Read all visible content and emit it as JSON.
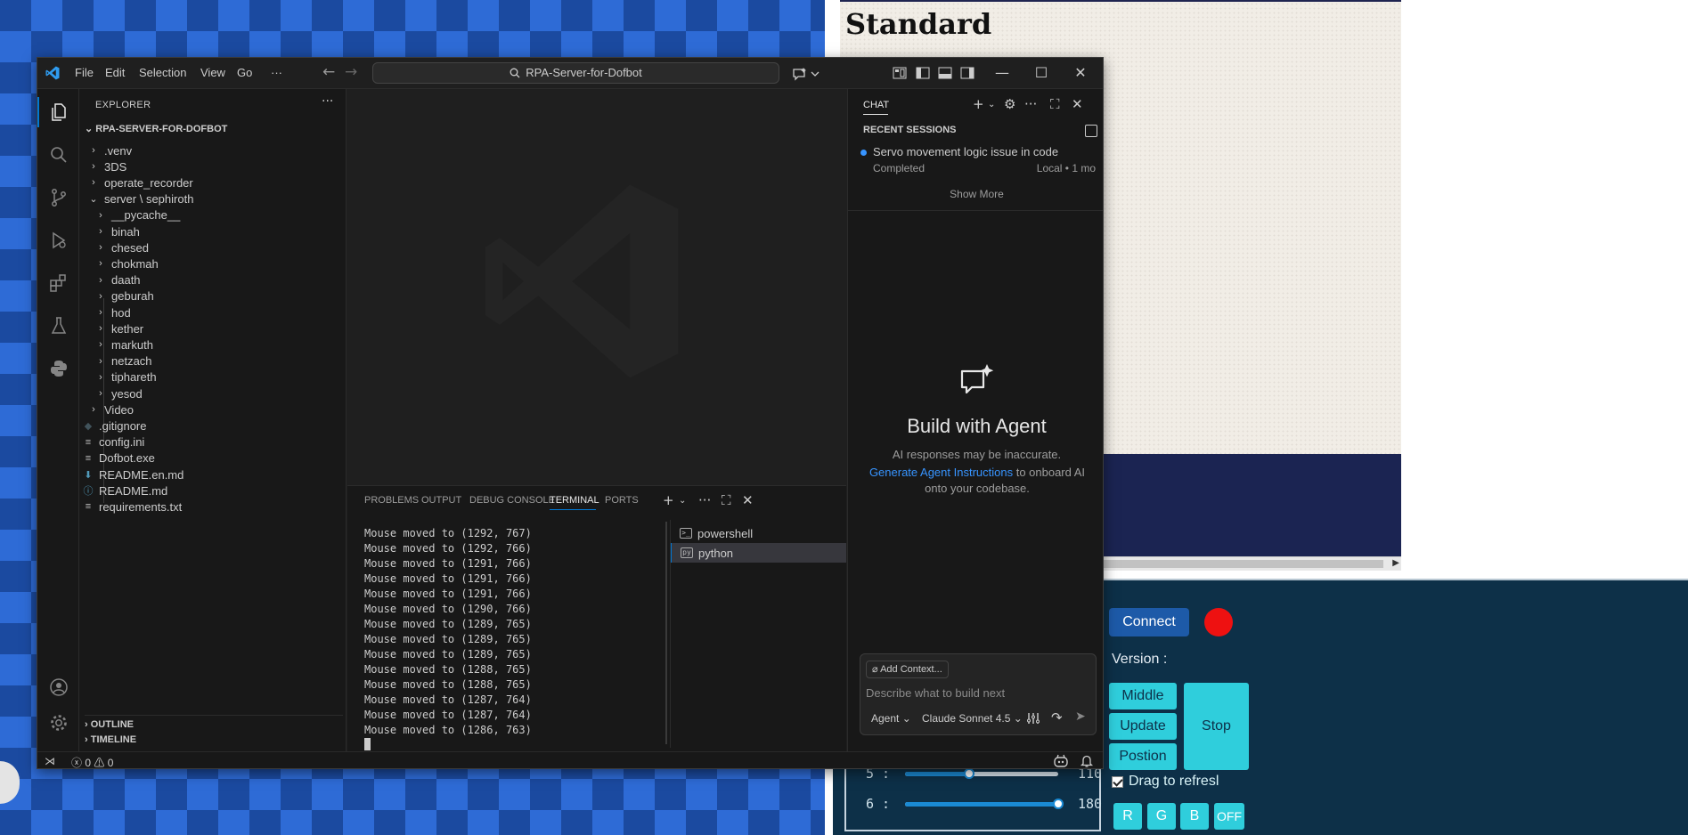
{
  "window": {
    "menus": [
      "File",
      "Edit",
      "Selection",
      "View",
      "Go",
      "···"
    ],
    "search_text": "RPA-Server-for-Dofbot"
  },
  "explorer": {
    "title": "EXPLORER",
    "root": "RPA-SERVER-FOR-DOFBOT",
    "items": [
      {
        "label": ".venv",
        "type": "folder",
        "depth": 0,
        "expanded": false
      },
      {
        "label": "3DS",
        "type": "folder",
        "depth": 0,
        "expanded": false
      },
      {
        "label": "operate_recorder",
        "type": "folder",
        "depth": 0,
        "expanded": false
      },
      {
        "label": "server \\ sephiroth",
        "type": "folder",
        "depth": 0,
        "expanded": true
      },
      {
        "label": "__pycache__",
        "type": "folder",
        "depth": 1,
        "expanded": false
      },
      {
        "label": "binah",
        "type": "folder",
        "depth": 1,
        "expanded": false
      },
      {
        "label": "chesed",
        "type": "folder",
        "depth": 1,
        "expanded": false
      },
      {
        "label": "chokmah",
        "type": "folder",
        "depth": 1,
        "expanded": false
      },
      {
        "label": "daath",
        "type": "folder",
        "depth": 1,
        "expanded": false
      },
      {
        "label": "geburah",
        "type": "folder",
        "depth": 1,
        "expanded": false
      },
      {
        "label": "hod",
        "type": "folder",
        "depth": 1,
        "expanded": false
      },
      {
        "label": "kether",
        "type": "folder",
        "depth": 1,
        "expanded": false
      },
      {
        "label": "markuth",
        "type": "folder",
        "depth": 1,
        "expanded": false
      },
      {
        "label": "netzach",
        "type": "folder",
        "depth": 1,
        "expanded": false
      },
      {
        "label": "tiphareth",
        "type": "folder",
        "depth": 1,
        "expanded": false
      },
      {
        "label": "yesod",
        "type": "folder",
        "depth": 1,
        "expanded": false
      },
      {
        "label": "Video",
        "type": "folder",
        "depth": 0,
        "expanded": false
      },
      {
        "label": ".gitignore",
        "type": "file",
        "icon": "gitignore-file-icon",
        "depth": 0
      },
      {
        "label": "config.ini",
        "type": "file",
        "icon": "settings-file-icon",
        "depth": 0
      },
      {
        "label": "Dofbot.exe",
        "type": "file",
        "icon": "binary-file-icon",
        "depth": 0
      },
      {
        "label": "README.en.md",
        "type": "file",
        "icon": "markdown-file-icon",
        "depth": 0
      },
      {
        "label": "README.md",
        "type": "file",
        "icon": "info-file-icon",
        "depth": 0
      },
      {
        "label": "requirements.txt",
        "type": "file",
        "icon": "text-file-icon",
        "depth": 0
      }
    ],
    "outline": "OUTLINE",
    "timeline": "TIMELINE"
  },
  "panel": {
    "tabs": [
      "PROBLEMS",
      "OUTPUT",
      "DEBUG CONSOLE",
      "TERMINAL",
      "PORTS"
    ],
    "active_tab": "TERMINAL",
    "terminal_lines": [
      "Mouse moved to (1292, 767)",
      "Mouse moved to (1292, 766)",
      "Mouse moved to (1291, 766)",
      "Mouse moved to (1291, 766)",
      "Mouse moved to (1291, 766)",
      "Mouse moved to (1290, 766)",
      "Mouse moved to (1289, 765)",
      "Mouse moved to (1289, 765)",
      "Mouse moved to (1289, 765)",
      "Mouse moved to (1288, 765)",
      "Mouse moved to (1288, 765)",
      "Mouse moved to (1287, 764)",
      "Mouse moved to (1287, 764)",
      "Mouse moved to (1286, 763)"
    ],
    "terminals": [
      "powershell",
      "python"
    ],
    "active_terminal": "python"
  },
  "chat": {
    "title": "CHAT",
    "recent_header": "RECENT SESSIONS",
    "session_title": "Servo movement logic issue in code",
    "session_status": "Completed",
    "session_meta": "Local • 1 mo",
    "show_more": "Show More",
    "agent_title": "Build with Agent",
    "disclaimer": "AI responses may be inaccurate.",
    "instr_link": "Generate Agent Instructions",
    "instr_rest": " to onboard AI onto your codebase.",
    "add_context": "Add Context...",
    "placeholder": "Describe what to build next",
    "mode": "Agent",
    "model": "Claude Sonnet 4.5"
  },
  "statusbar": {
    "errors": "0",
    "warnings": "0"
  },
  "background": {
    "standard_title": "Standard",
    "connect": "Connect",
    "version_label": "Version :",
    "buttons": {
      "middle": "Middle",
      "update": "Update",
      "position": "Postion",
      "stop": "Stop"
    },
    "drag_refresh": "Drag to refresl",
    "rgb": [
      "R",
      "G",
      "B",
      "OFF"
    ],
    "sliders": [
      {
        "label": "5 :",
        "value": "110",
        "fraction": 0.42
      },
      {
        "label": "6 :",
        "value": "180",
        "fraction": 1.0
      }
    ]
  },
  "colors": {
    "accent": "#0078d4",
    "link": "#3794ff",
    "status_dot": "#ee1111",
    "cyan_button": "#2fcedc"
  }
}
